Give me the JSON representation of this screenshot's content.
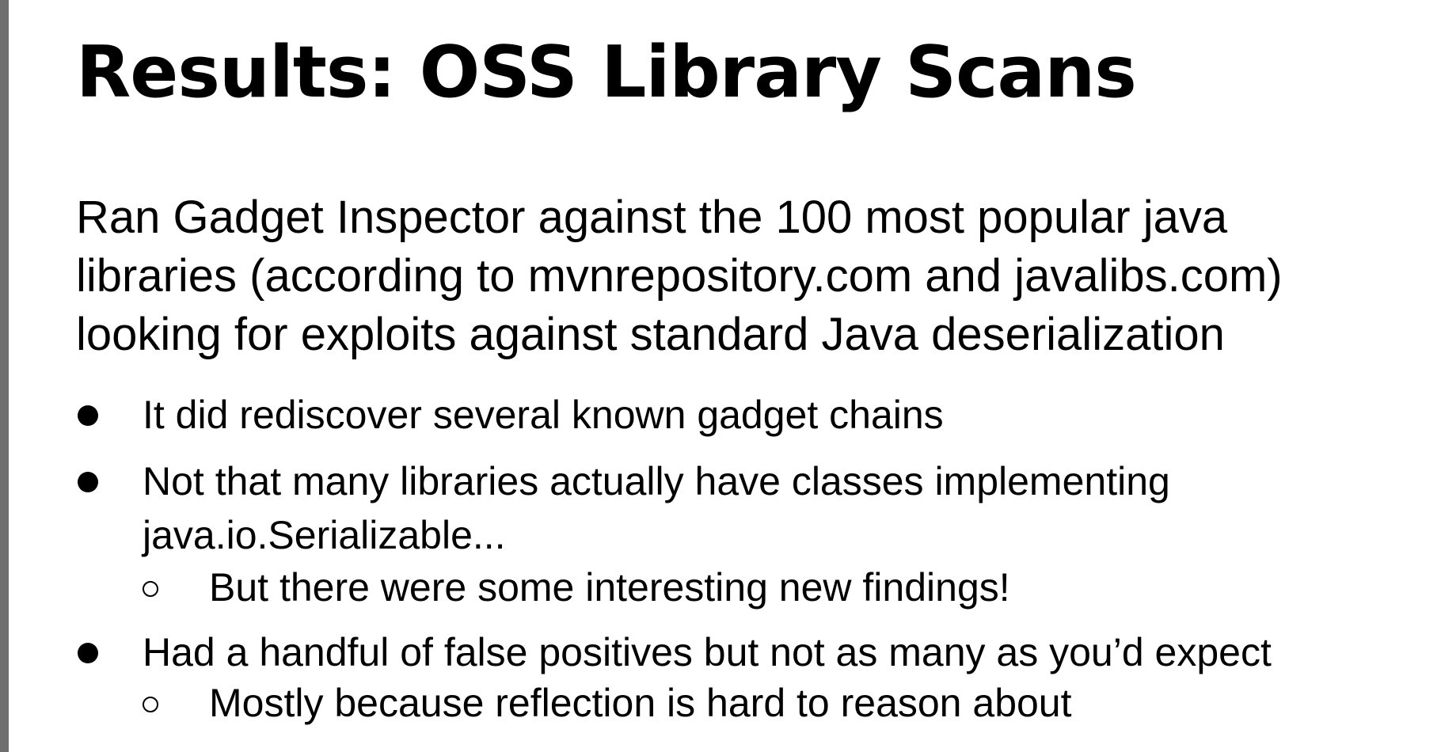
{
  "slide": {
    "title": "Results: OSS Library Scans",
    "intro_lines": [
      "Ran Gadget Inspector against the 100 most popular java",
      "libraries (according to mvnrepository.com and javalibs.com)",
      "looking for exploits against standard Java deserialization"
    ],
    "bullets": [
      {
        "lines": [
          "It did rediscover several known gadget chains"
        ],
        "subs": []
      },
      {
        "lines": [
          "Not that many libraries actually have classes implementing",
          "java.io.Serializable..."
        ],
        "subs": [
          "But there were some interesting new findings!"
        ]
      },
      {
        "lines": [
          "Had a handful of false positives but not as many as you’d expect"
        ],
        "subs": [
          "Mostly because reflection is hard to reason about"
        ]
      }
    ]
  }
}
